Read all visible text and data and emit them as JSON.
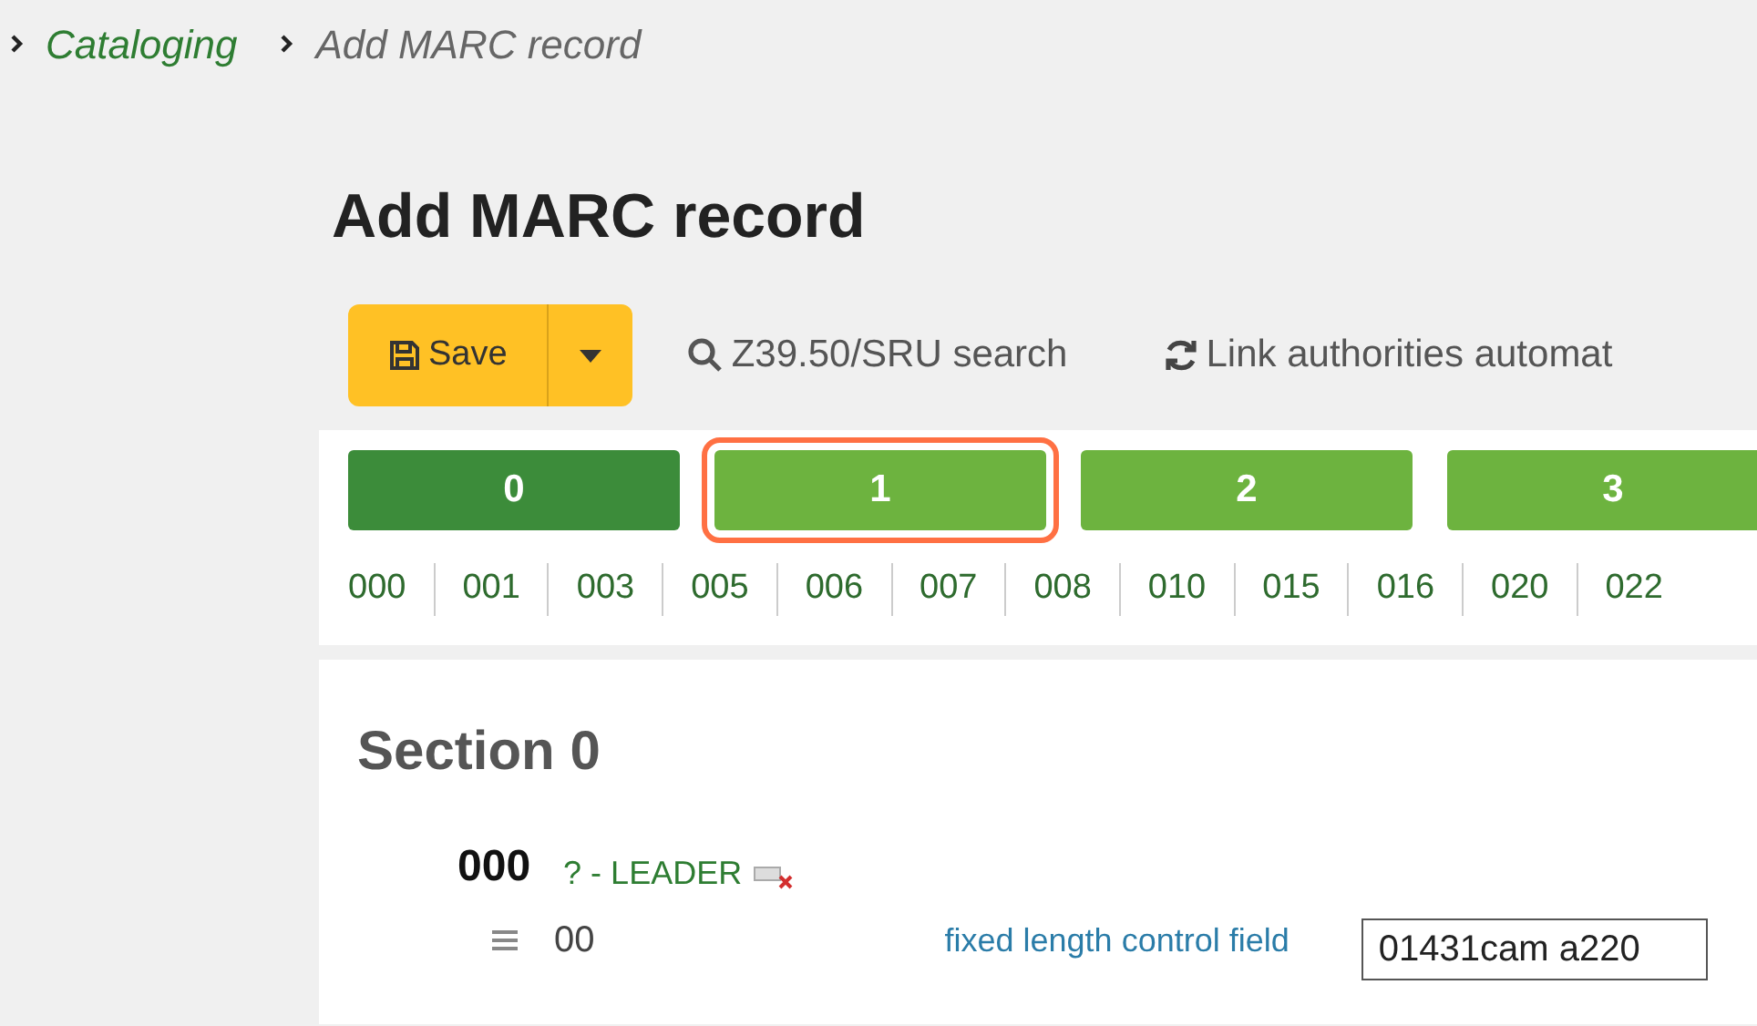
{
  "breadcrumbs": [
    {
      "label": "Cataloging",
      "kind": "link"
    },
    {
      "label": "Add MARC record",
      "kind": "current"
    }
  ],
  "title": "Add MARC record",
  "toolbar": {
    "save": "Save",
    "z3950": "Z39.50/SRU search",
    "link_authorities": "Link authorities automat"
  },
  "tabs": [
    {
      "label": "0",
      "selected": true,
      "highlighted": false
    },
    {
      "label": "1",
      "selected": false,
      "highlighted": true
    },
    {
      "label": "2",
      "selected": false,
      "highlighted": false
    },
    {
      "label": "3",
      "selected": false,
      "highlighted": false
    }
  ],
  "tag_links": [
    "000",
    "001",
    "003",
    "005",
    "006",
    "007",
    "008",
    "010",
    "015",
    "016",
    "020",
    "022"
  ],
  "section": {
    "title": "Section 0",
    "field": {
      "tag": "000",
      "description": "? - LEADER",
      "subfield": "00",
      "label": "fixed length control field",
      "value": "01431cam a220"
    }
  }
}
